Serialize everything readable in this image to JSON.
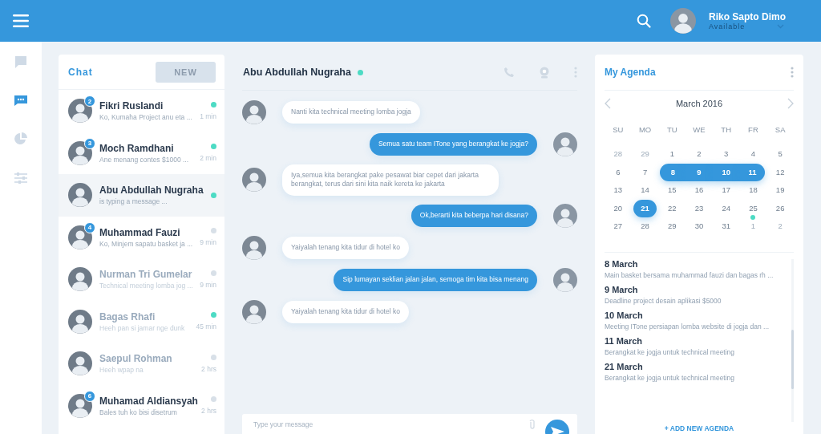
{
  "header": {
    "user_name": "Riko Sapto Dimo",
    "user_status": "Available"
  },
  "chat_list": {
    "title": "Chat",
    "new_button": "NEW",
    "items": [
      {
        "name": "Fikri Ruslandi",
        "preview": "Ko, Kumaha Project anu eta ...",
        "time": "1 min",
        "unread": "2",
        "online": true,
        "muted": false,
        "selected": false
      },
      {
        "name": "Moch Ramdhani",
        "preview": "Ane menang contes $1000 ...",
        "time": "2 min",
        "unread": "3",
        "online": true,
        "muted": false,
        "selected": false
      },
      {
        "name": "Abu Abdullah Nugraha",
        "preview": "is typing a message ...",
        "online": true,
        "muted": false,
        "selected": true
      },
      {
        "name": "Muhammad Fauzi",
        "preview": "Ko, Minjem sapatu basket ja ...",
        "time": "9 min",
        "unread": "4",
        "online": false,
        "muted": false,
        "selected": false
      },
      {
        "name": "Nurman Tri Gumelar",
        "preview": "Technical meeting lomba jog ...",
        "time": "9 min",
        "online": false,
        "muted": true,
        "selected": false
      },
      {
        "name": "Bagas Rhafi",
        "preview": "Heeh pan si jamar nge dunk",
        "time": "45 min",
        "online": true,
        "muted": true,
        "selected": false
      },
      {
        "name": "Saepul Rohman",
        "preview": "Heeh wpap na",
        "time": "2 hrs",
        "online": false,
        "muted": true,
        "selected": false
      },
      {
        "name": "Muhamad Aldiansyah",
        "preview": "Bales tuh ko bisi disetrum",
        "time": "2 hrs",
        "unread": "6",
        "online": false,
        "muted": false,
        "selected": false
      }
    ]
  },
  "conversation": {
    "contact": "Abu Abdullah Nugraha",
    "online": true,
    "messages": [
      {
        "kind": "in",
        "text": "Nanti  kita technical meeting lomba jogja"
      },
      {
        "kind": "out",
        "text": "Semua satu team ITone yang berangkat ke jogja?"
      },
      {
        "kind": "in",
        "text": "Iya,semua kita berangkat pake pesawat biar cepet dari  jakarta berangkat, terus dari sini kita naik kereta ke jakarta"
      },
      {
        "kind": "out",
        "text": "Ok,berarti kita beberpa hari disana?"
      },
      {
        "kind": "in",
        "text": "Yaiyalah tenang kita tidur di hotel ko"
      },
      {
        "kind": "out",
        "text": "Sip lumayan seklian jalan jalan, semoga tim kita bisa menang"
      },
      {
        "kind": "in",
        "text": "Yaiyalah tenang kita tidur di hotel ko"
      }
    ],
    "input": {
      "placeholder": "Type your message"
    }
  },
  "agenda": {
    "title": "My Agenda",
    "month": "March 2016",
    "weekdays": [
      "SU",
      "MO",
      "TU",
      "WE",
      "TH",
      "FR",
      "SA"
    ],
    "days": [
      {
        "label": "28",
        "muted": true,
        "selected": false,
        "event": false
      },
      {
        "label": "29",
        "muted": true,
        "selected": false,
        "event": false
      },
      {
        "label": "1",
        "muted": false,
        "selected": false,
        "event": false
      },
      {
        "label": "2",
        "muted": false,
        "selected": false,
        "event": false
      },
      {
        "label": "3",
        "muted": false,
        "selected": false,
        "event": false
      },
      {
        "label": "4",
        "muted": false,
        "selected": false,
        "event": false
      },
      {
        "label": "5",
        "muted": false,
        "selected": false,
        "event": false
      },
      {
        "label": "6",
        "muted": false,
        "selected": false,
        "event": false
      },
      {
        "label": "7",
        "muted": false,
        "selected": false,
        "event": false
      },
      {
        "label": "8",
        "muted": false,
        "selected": true,
        "event": false
      },
      {
        "label": "9",
        "muted": false,
        "selected": true,
        "event": false
      },
      {
        "label": "10",
        "muted": false,
        "selected": true,
        "event": false
      },
      {
        "label": "11",
        "muted": false,
        "selected": true,
        "event": false
      },
      {
        "label": "12",
        "muted": false,
        "selected": false,
        "event": false
      },
      {
        "label": "13",
        "muted": false,
        "selected": false,
        "event": false
      },
      {
        "label": "14",
        "muted": false,
        "selected": false,
        "event": false
      },
      {
        "label": "15",
        "muted": false,
        "selected": false,
        "event": false
      },
      {
        "label": "16",
        "muted": false,
        "selected": false,
        "event": false
      },
      {
        "label": "17",
        "muted": false,
        "selected": false,
        "event": false
      },
      {
        "label": "18",
        "muted": false,
        "selected": false,
        "event": false
      },
      {
        "label": "19",
        "muted": false,
        "selected": false,
        "event": false
      },
      {
        "label": "20",
        "muted": false,
        "selected": false,
        "event": false
      },
      {
        "label": "21",
        "muted": false,
        "selected": true,
        "event": false
      },
      {
        "label": "22",
        "muted": false,
        "selected": false,
        "event": false
      },
      {
        "label": "23",
        "muted": false,
        "selected": false,
        "event": false
      },
      {
        "label": "24",
        "muted": false,
        "selected": false,
        "event": false
      },
      {
        "label": "25",
        "muted": false,
        "selected": false,
        "event": true
      },
      {
        "label": "26",
        "muted": false,
        "selected": false,
        "event": false
      },
      {
        "label": "27",
        "muted": false,
        "selected": false,
        "event": false
      },
      {
        "label": "28",
        "muted": false,
        "selected": false,
        "event": false
      },
      {
        "label": "29",
        "muted": false,
        "selected": false,
        "event": false
      },
      {
        "label": "30",
        "muted": false,
        "selected": false,
        "event": false
      },
      {
        "label": "31",
        "muted": false,
        "selected": false,
        "event": false
      },
      {
        "label": "1",
        "muted": true,
        "selected": false,
        "event": false
      },
      {
        "label": "2",
        "muted": true,
        "selected": false,
        "event": false
      }
    ],
    "events": [
      {
        "date": "8 March",
        "text": "Main basket bersama muhammad fauzi dan bagas rh ..."
      },
      {
        "date": "9 March",
        "text": "Deadline project desain aplikasi $5000"
      },
      {
        "date": "10 March",
        "text": "Meeting ITone persiapan lomba website di jogja dan ..."
      },
      {
        "date": "11 March",
        "text": "Berangkat ke jogja untuk technical meeting"
      },
      {
        "date": "21 March",
        "text": "Berangkat ke jogja untuk technical meeting"
      }
    ],
    "add_button": "+ ADD NEW AGENDA"
  }
}
